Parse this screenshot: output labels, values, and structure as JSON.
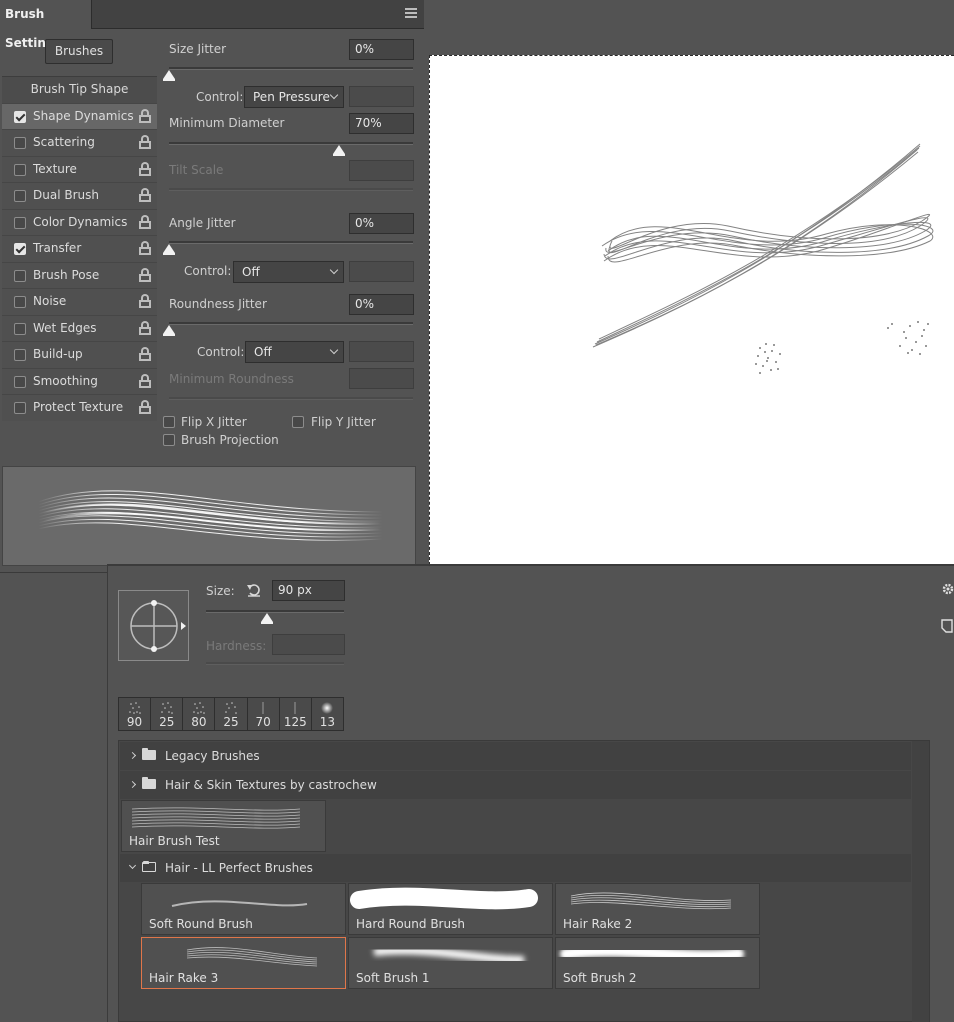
{
  "brush_settings": {
    "tab_title": "Brush Settings",
    "brushes_button": "Brushes",
    "options_header": "Brush Tip Shape",
    "options": [
      {
        "label": "Shape Dynamics",
        "checked": true,
        "active": true
      },
      {
        "label": "Scattering",
        "checked": false,
        "active": false
      },
      {
        "label": "Texture",
        "checked": false,
        "active": false
      },
      {
        "label": "Dual Brush",
        "checked": false,
        "active": false
      },
      {
        "label": "Color Dynamics",
        "checked": false,
        "active": false
      },
      {
        "label": "Transfer",
        "checked": true,
        "active": false
      },
      {
        "label": "Brush Pose",
        "checked": false,
        "active": false
      },
      {
        "label": "Noise",
        "checked": false,
        "active": false
      },
      {
        "label": "Wet Edges",
        "checked": false,
        "active": false
      },
      {
        "label": "Build-up",
        "checked": false,
        "active": false
      },
      {
        "label": "Smoothing",
        "checked": false,
        "active": false
      },
      {
        "label": "Protect Texture",
        "checked": false,
        "active": false
      }
    ],
    "size_jitter": {
      "label": "Size Jitter",
      "value": "0%",
      "level": 0
    },
    "size_control": {
      "label": "Control:",
      "value": "Pen Pressure"
    },
    "min_diameter": {
      "label": "Minimum Diameter",
      "value": "70%",
      "level": 0.7
    },
    "tilt_scale": {
      "label": "Tilt Scale"
    },
    "angle_jitter": {
      "label": "Angle Jitter",
      "value": "0%",
      "level": 0
    },
    "angle_control": {
      "label": "Control:",
      "value": "Off"
    },
    "roundness_jitter": {
      "label": "Roundness Jitter",
      "value": "0%",
      "level": 0
    },
    "roundness_control": {
      "label": "Control:",
      "value": "Off"
    },
    "min_roundness": {
      "label": "Minimum Roundness"
    },
    "flip_x": "Flip X Jitter",
    "flip_y": "Flip Y Jitter",
    "brush_projection": "Brush Projection"
  },
  "picker": {
    "size_label": "Size:",
    "size_value": "90 px",
    "size_level": 0.45,
    "hardness_label": "Hardness:",
    "recent_brushes": [
      "90",
      "25",
      "80",
      "25",
      "70",
      "125",
      "13"
    ],
    "groups": [
      {
        "label": "Legacy Brushes",
        "expanded": false
      },
      {
        "label": "Hair & Skin Textures by castrochew",
        "expanded": false
      }
    ],
    "loose_preset": "Hair Brush Test",
    "open_group": "Hair - LL Perfect Brushes",
    "presets": [
      {
        "label": "Soft Round Brush",
        "selected": false
      },
      {
        "label": "Hard Round Brush",
        "selected": false
      },
      {
        "label": "Hair Rake 2",
        "selected": false
      },
      {
        "label": "Hair Rake 3",
        "selected": true
      },
      {
        "label": "Soft Brush 1",
        "selected": false
      },
      {
        "label": "Soft Brush 2",
        "selected": false
      }
    ]
  },
  "colors": {
    "panel": "#535353",
    "selection_border": "#e0764a",
    "canvas": "#ffffff"
  }
}
